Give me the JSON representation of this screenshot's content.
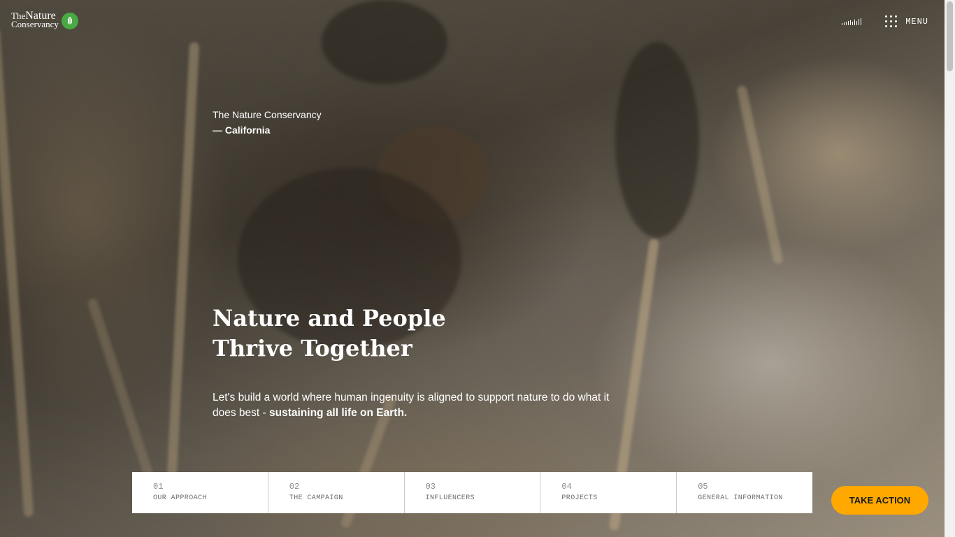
{
  "header": {
    "logo": {
      "line1_small": "The",
      "line1_big": "Nature",
      "line2": "Conservancy"
    },
    "menu_label": "MENU"
  },
  "hero": {
    "org_name": "The Nature Conservancy",
    "region": "— California",
    "headline_line1": "Nature and People",
    "headline_line2": "Thrive Together",
    "subtext_plain": "Let's build a world where human ingenuity is aligned to support nature to do what it does best - ",
    "subtext_bold": "sustaining all life on Earth."
  },
  "nav": {
    "items": [
      {
        "num": "01",
        "label": "OUR APPROACH"
      },
      {
        "num": "02",
        "label": "THE CAMPAIGN"
      },
      {
        "num": "03",
        "label": "INFLUENCERS"
      },
      {
        "num": "04",
        "label": "PROJECTS"
      },
      {
        "num": "05",
        "label": "GENERAL INFORMATION"
      }
    ]
  },
  "cta": {
    "label": "TAKE ACTION"
  },
  "icons": {
    "logo_badge": "leaf-globe-icon",
    "sound": "sound-bars-icon",
    "menu": "grid-dots-icon"
  },
  "colors": {
    "accent": "#ffa800",
    "logo_green": "#49a942",
    "nav_bg": "#ffffff"
  }
}
